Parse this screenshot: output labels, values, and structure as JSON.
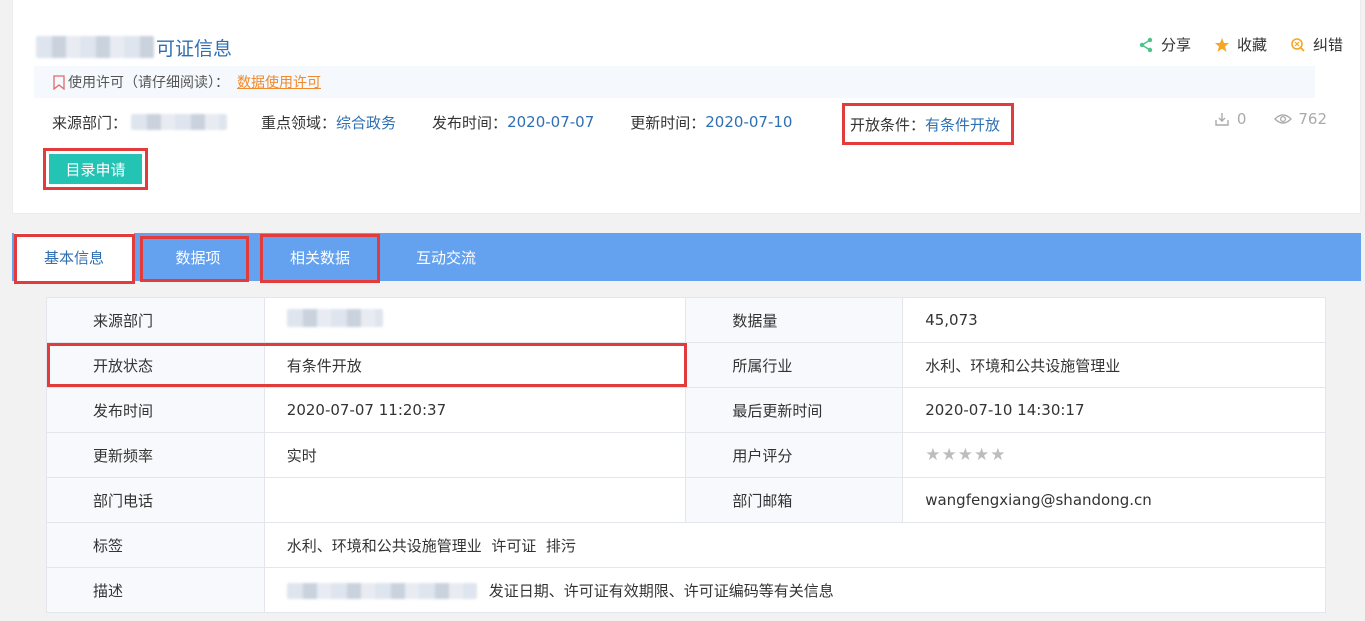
{
  "header": {
    "title_suffix": "可证信息",
    "actions": [
      {
        "name": "share",
        "label": "分享",
        "color": "#4cc38a"
      },
      {
        "name": "favorite",
        "label": "收藏",
        "color": "#f5a623"
      },
      {
        "name": "report",
        "label": "纠错",
        "color": "#f5a623"
      }
    ]
  },
  "license": {
    "label": "使用许可（请仔细阅读）：",
    "link": "数据使用许可"
  },
  "meta": {
    "source_label": "来源部门：",
    "domain_label": "重点领域：",
    "domain_value": "综合政务",
    "publish_label": "发布时间：",
    "publish_value": "2020-07-07",
    "update_label": "更新时间：",
    "update_value": "2020-07-10",
    "open_label": "开放条件：",
    "open_value": "有条件开放",
    "downloads": "0",
    "views": "762"
  },
  "apply_button": "目录申请",
  "tabs": [
    "基本信息",
    "数据项",
    "相关数据",
    "互动交流"
  ],
  "table": {
    "rows": [
      {
        "k1": "来源部门",
        "v1": "",
        "k2": "数据量",
        "v2": "45,073"
      },
      {
        "k1": "开放状态",
        "v1": "有条件开放",
        "k2": "所属行业",
        "v2": "水利、环境和公共设施管理业"
      },
      {
        "k1": "发布时间",
        "v1": "2020-07-07 11:20:37",
        "k2": "最后更新时间",
        "v2": "2020-07-10 14:30:17"
      },
      {
        "k1": "更新频率",
        "v1": "实时",
        "k2": "用户评分",
        "v2": ""
      },
      {
        "k1": "部门电话",
        "v1": "",
        "k2": "部门邮箱",
        "v2": "wangfengxiang@shandong.cn"
      }
    ],
    "tags_label": "标签",
    "tags_value": "水利、环境和公共设施管理业  许可证  排污",
    "desc_label": "描述",
    "desc_value": "发证日期、许可证有效期限、许可证编码等有关信息"
  },
  "rating": {
    "score": 0,
    "max": 5
  }
}
